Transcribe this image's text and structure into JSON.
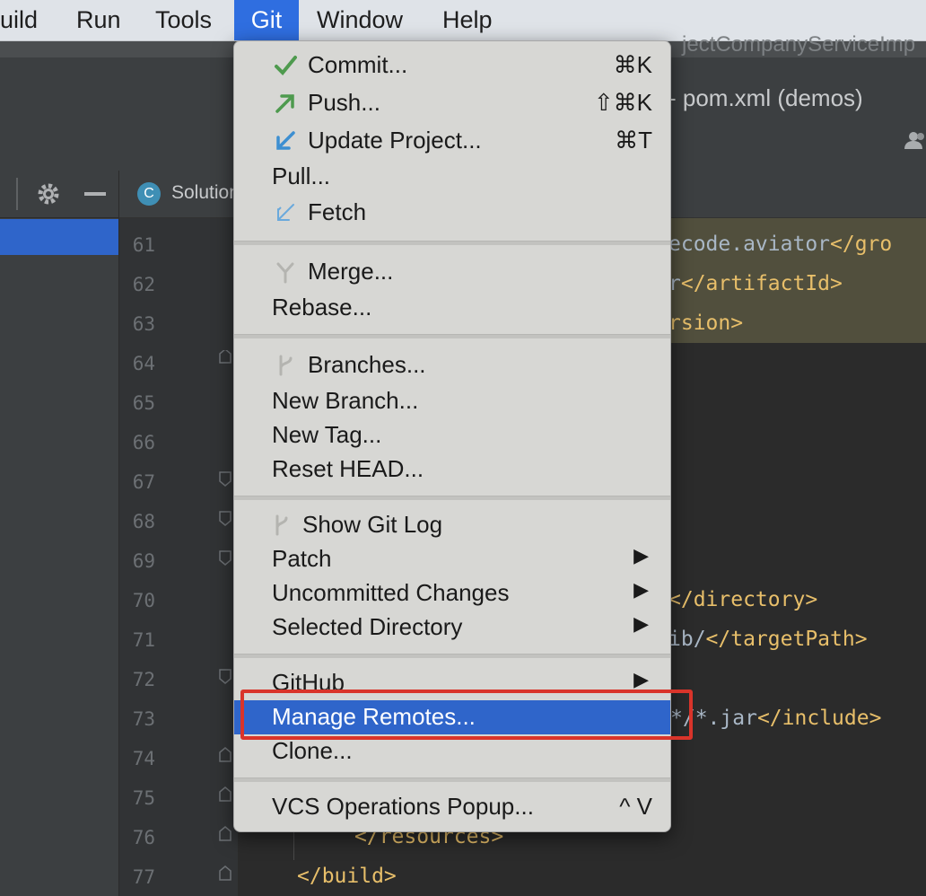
{
  "menubar": {
    "items": [
      "uild",
      "Run",
      "Tools",
      "Git",
      "Window",
      "Help"
    ],
    "active": "Git"
  },
  "titlebar": {
    "faded_title": "jectCompanyServiceImp",
    "title": "- pom.xml (demos)"
  },
  "tab": {
    "label": "Solution"
  },
  "editor": {
    "line_numbers": [
      "61",
      "62",
      "63",
      "64",
      "65",
      "66",
      "67",
      "68",
      "69",
      "70",
      "71",
      "72",
      "73",
      "74",
      "75",
      "76",
      "77"
    ],
    "lines": {
      "61": [
        "ecode.aviator",
        "</gro"
      ],
      "62": [
        "r",
        "</artifactId>"
      ],
      "63": [
        "rsion>"
      ],
      "70": [
        "</directory>"
      ],
      "71": [
        "ib/",
        "</targetPath>"
      ],
      "73": [
        "*",
        "/*.jar",
        "</include>"
      ],
      "76": [
        "</resources>"
      ],
      "77": [
        "</build>"
      ]
    }
  },
  "git_menu": {
    "commit": {
      "label": "Commit...",
      "shortcut": "⌘K",
      "icon": "check-icon"
    },
    "push": {
      "label": "Push...",
      "shortcut": "⇧⌘K",
      "icon": "push-arrow-icon"
    },
    "update": {
      "label": "Update Project...",
      "shortcut": "⌘T",
      "icon": "update-arrow-icon"
    },
    "pull": {
      "label": "Pull..."
    },
    "fetch": {
      "label": "Fetch",
      "icon": "fetch-arrow-icon"
    },
    "merge": {
      "label": "Merge...",
      "icon": "merge-icon"
    },
    "rebase": {
      "label": "Rebase..."
    },
    "branches": {
      "label": "Branches...",
      "icon": "branch-icon"
    },
    "new_branch": {
      "label": "New Branch..."
    },
    "new_tag": {
      "label": "New Tag..."
    },
    "reset_head": {
      "label": "Reset HEAD..."
    },
    "show_git_log": {
      "label": "Show Git Log",
      "icon": "git-log-icon"
    },
    "patch": {
      "label": "Patch",
      "arrow": "▶"
    },
    "uncommitted": {
      "label": "Uncommitted Changes",
      "arrow": "▶"
    },
    "selected_dir": {
      "label": "Selected Directory",
      "arrow": "▶"
    },
    "github": {
      "label": "GitHub",
      "arrow": "▶"
    },
    "manage_remotes": {
      "label": "Manage Remotes..."
    },
    "clone": {
      "label": "Clone..."
    },
    "vcs_popup": {
      "label": "VCS Operations Popup...",
      "shortcut": "^ V"
    }
  },
  "colors": {
    "accent": "#2f65ca",
    "highlight_box": "#d9342a",
    "tag": "#e8bf6a"
  }
}
